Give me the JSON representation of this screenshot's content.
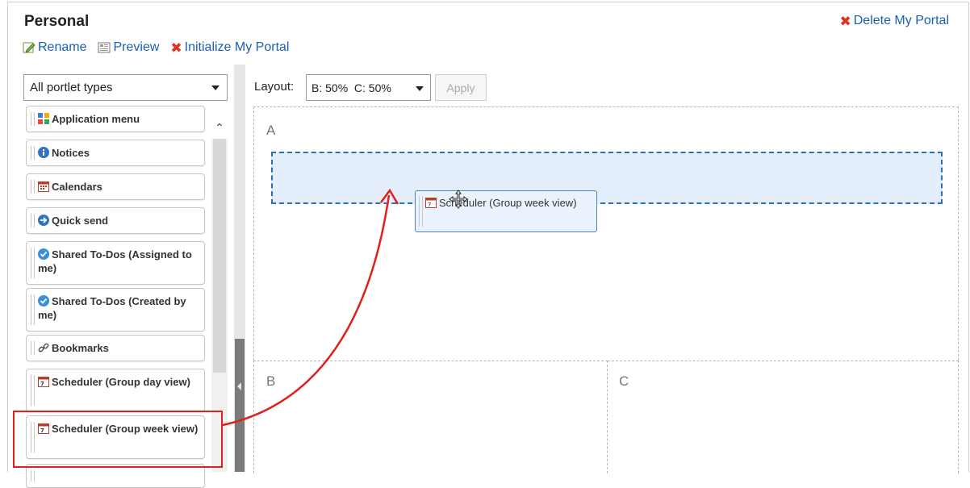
{
  "header": {
    "title": "Personal",
    "delete_label": "Delete My Portal"
  },
  "toolbar": {
    "rename_label": "Rename",
    "preview_label": "Preview",
    "initialize_label": "Initialize My Portal"
  },
  "palette": {
    "filter_value": "All portlet types",
    "items": [
      {
        "label": "Application menu",
        "icon": "app-menu-icon"
      },
      {
        "label": "Notices",
        "icon": "info-icon"
      },
      {
        "label": "Calendars",
        "icon": "calendar-icon"
      },
      {
        "label": "Quick send",
        "icon": "send-icon"
      },
      {
        "label": "Shared To-Dos (Assigned to me)",
        "icon": "todo-icon"
      },
      {
        "label": "Shared To-Dos (Created by me)",
        "icon": "todo-icon"
      },
      {
        "label": "Bookmarks",
        "icon": "link-icon"
      },
      {
        "label": "Scheduler (Group day view)",
        "icon": "scheduler-icon"
      },
      {
        "label": "Scheduler (Group week view)",
        "icon": "scheduler-icon"
      }
    ]
  },
  "layout": {
    "label": "Layout:",
    "selected": "B: 50%  C: 50%",
    "apply_label": "Apply",
    "zones": [
      "A",
      "B",
      "C"
    ]
  },
  "drag": {
    "label": "Scheduler (Group week view)"
  },
  "colors": {
    "link": "#1a5fb4",
    "highlight": "#e0201b",
    "drop_target_fill": "#e3eefa",
    "drop_target_border": "#2a6fb8"
  }
}
